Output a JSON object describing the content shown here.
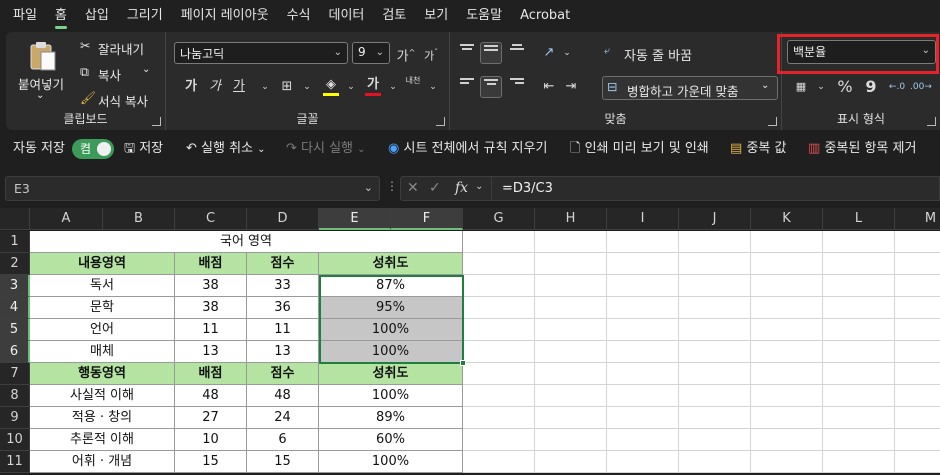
{
  "menu": [
    "파일",
    "홈",
    "삽입",
    "그리기",
    "페이지 레이아웃",
    "수식",
    "데이터",
    "검토",
    "보기",
    "도움말",
    "Acrobat"
  ],
  "menu_active": "홈",
  "ribbon": {
    "clipboard": {
      "paste_label": "붙여넣기",
      "cut_label": "잘라내기",
      "copy_label": "복사",
      "format_painter_label": "서식 복사",
      "group_label": "클립보드"
    },
    "font": {
      "font_name": "나눔고딕",
      "font_size": "9",
      "grow_label": "가",
      "shrink_label": "가",
      "bold_label": "가",
      "italic_label": "가",
      "underline_label": "가",
      "font_color_label": "가",
      "phonetic_label": "내천",
      "group_label": "글꼴",
      "fill_color": "#ffff00",
      "text_color": "#e81123"
    },
    "alignment": {
      "wrap_label": "자동 줄 바꿈",
      "merge_label": "병합하고 가운데 맞춤",
      "group_label": "맞춤"
    },
    "number": {
      "format_value": "백분율",
      "percent_label": "%",
      "comma_label": "9",
      "group_label": "표시 형식"
    }
  },
  "qat": {
    "autosave_label": "자동 저장",
    "toggle_state": "켬",
    "save_label": "저장",
    "undo_label": "실행 취소",
    "redo_label": "다시 실행",
    "clear_rules_label": "시트 전체에서 규칙 지우기",
    "print_preview_label": "인쇄 미리 보기 및 인쇄",
    "duplicates_label": "중복 값",
    "remove_duplicates_label": "중복된 항목 제거"
  },
  "formula_bar": {
    "name_box": "E3",
    "formula": "=D3/C3",
    "fx_label": "fx"
  },
  "columns": [
    "A",
    "B",
    "C",
    "D",
    "E",
    "F",
    "G",
    "H",
    "I",
    "J",
    "K",
    "L",
    "M"
  ],
  "rows": [
    "1",
    "2",
    "3",
    "4",
    "5",
    "6",
    "7",
    "8",
    "9",
    "10",
    "11"
  ],
  "sheet": {
    "title": "국어 영역",
    "header1": [
      "내용영역",
      "배점",
      "점수",
      "성취도"
    ],
    "body1": [
      [
        "독서",
        "38",
        "33",
        "87%"
      ],
      [
        "문학",
        "38",
        "36",
        "95%"
      ],
      [
        "언어",
        "11",
        "11",
        "100%"
      ],
      [
        "매체",
        "13",
        "13",
        "100%"
      ]
    ],
    "header2": [
      "행동영역",
      "배점",
      "점수",
      "성취도"
    ],
    "body2": [
      [
        "사실적 이해",
        "48",
        "48",
        "100%"
      ],
      [
        "적용 · 창의",
        "27",
        "24",
        "89%"
      ],
      [
        "추론적 이해",
        "10",
        "6",
        "60%"
      ],
      [
        "어휘 · 개념",
        "15",
        "15",
        "100%"
      ]
    ]
  }
}
